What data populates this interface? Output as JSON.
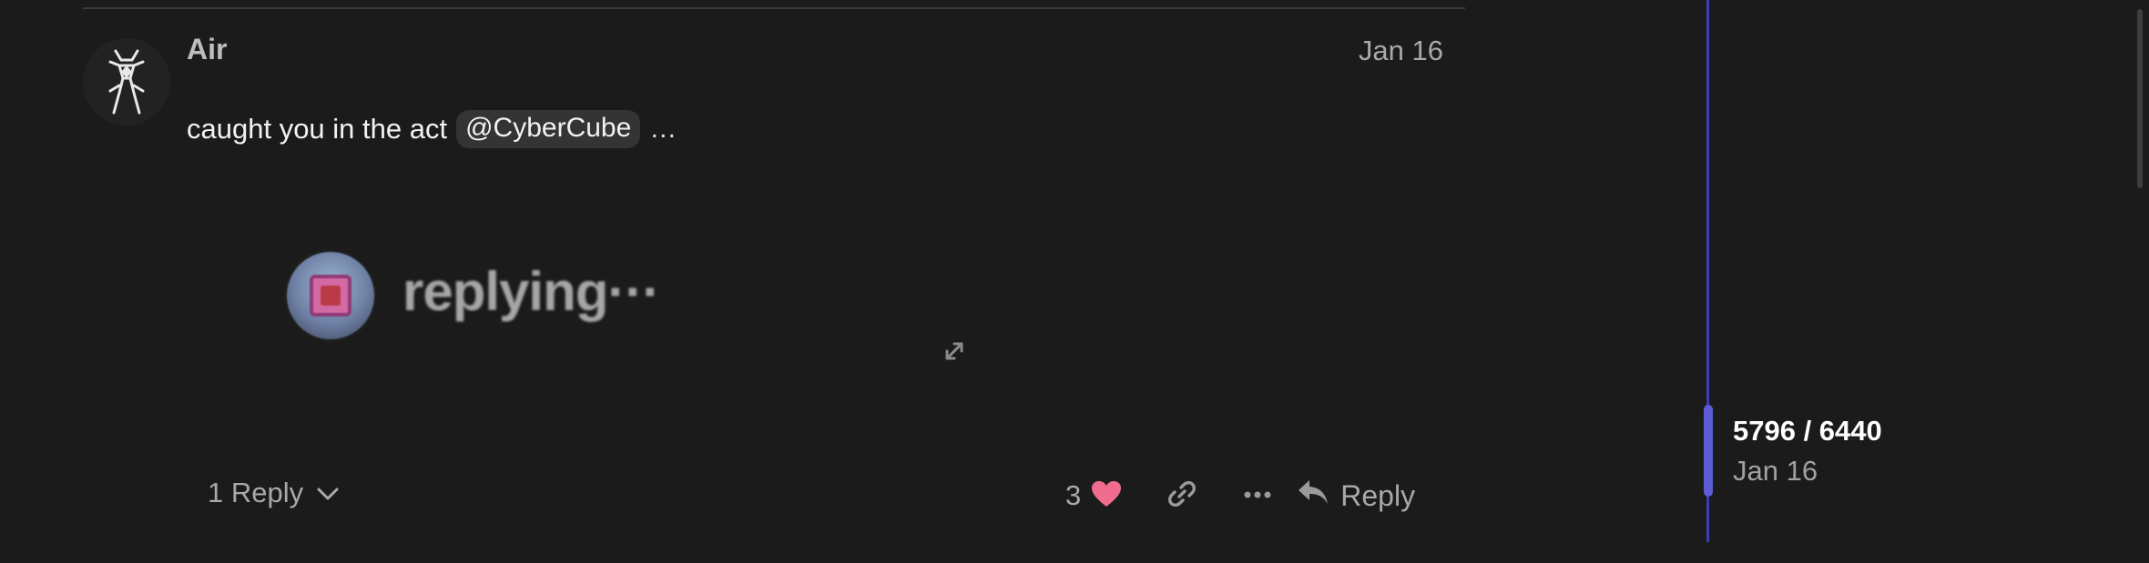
{
  "post": {
    "author": "Air",
    "date": "Jan 16",
    "text": "caught you in the act",
    "mention": "@CyberCube",
    "ellipsis": "…",
    "media": {
      "overlay_text": "replying···"
    },
    "replies_label": "1 Reply",
    "like_count": "3",
    "reply_button_label": "Reply"
  },
  "timeline": {
    "position": "5796 / 6440",
    "date": "Jan 16"
  },
  "icons": {
    "expand": "expand-icon",
    "chevron": "chevron-down-icon",
    "heart": "heart-icon",
    "link": "link-icon",
    "more": "more-icon",
    "reply": "reply-icon"
  },
  "colors": {
    "background": "#1b1b1b",
    "heart": "#f06c8f",
    "timeline_accent": "#5b5cd6",
    "timeline_line": "#3f3bb2",
    "mention_bg": "#343434"
  }
}
